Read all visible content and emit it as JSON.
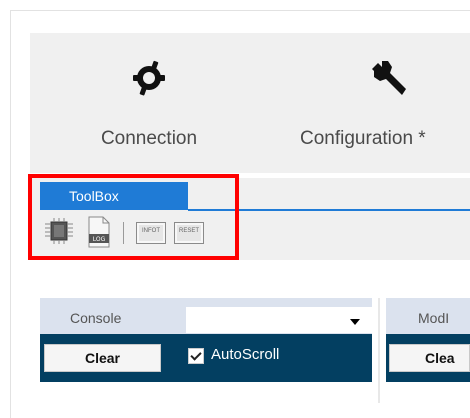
{
  "ribbon": {
    "connection_label": "Connection",
    "configuration_label": "Configuration *",
    "connection_icon": "plug-icon",
    "configuration_icon": "wrench-icon"
  },
  "toolbox": {
    "tab_label": "ToolBox",
    "items": [
      {
        "icon": "chip-icon"
      },
      {
        "icon": "log-icon",
        "text": "LOG"
      },
      {
        "icon": "infot-icon",
        "text": "INFOT"
      },
      {
        "icon": "reset-icon",
        "text": "RESET"
      }
    ]
  },
  "console": {
    "label": "Console",
    "dropdown_value": "",
    "clear_label": "Clear",
    "autoscroll_label": "AutoScroll",
    "autoscroll_checked": true
  },
  "modbus": {
    "label": "ModI",
    "clear_label": "Clea"
  },
  "colors": {
    "accent": "#1f7bd6",
    "console_bar": "#033f61",
    "highlight": "#ff0000",
    "header": "#dbe2ee"
  }
}
